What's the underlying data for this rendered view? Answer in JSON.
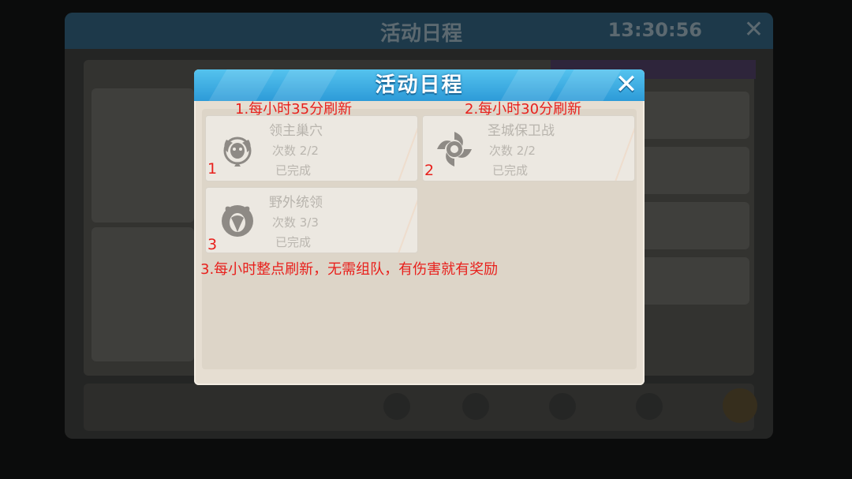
{
  "background": {
    "window_title": "活动日程",
    "timer": "13:30:56",
    "close_glyph": "✕"
  },
  "modal": {
    "title": "活动日程",
    "close_glyph": "✕"
  },
  "activities": [
    {
      "name": "领主巢穴",
      "count": "次数 2/2",
      "status": "已完成",
      "icon": "demon-lord-icon",
      "annotation_number": "1"
    },
    {
      "name": "圣城保卫战",
      "count": "次数 2/2",
      "status": "已完成",
      "icon": "swirl-emblem-icon",
      "annotation_number": "2"
    },
    {
      "name": "野外统领",
      "count": "次数 3/3",
      "status": "已完成",
      "icon": "wild-beast-icon",
      "annotation_number": "3"
    }
  ],
  "annotations": {
    "note1": "1.每小时35分刷新",
    "note2": "2.每小时30分刷新",
    "note3": "3.每小时整点刷新，无需组队，有伤害就有奖励"
  },
  "colors": {
    "annotation": "#e8201c",
    "header_blue": "#2d9bd8",
    "card_bg": "#ece8e1"
  }
}
